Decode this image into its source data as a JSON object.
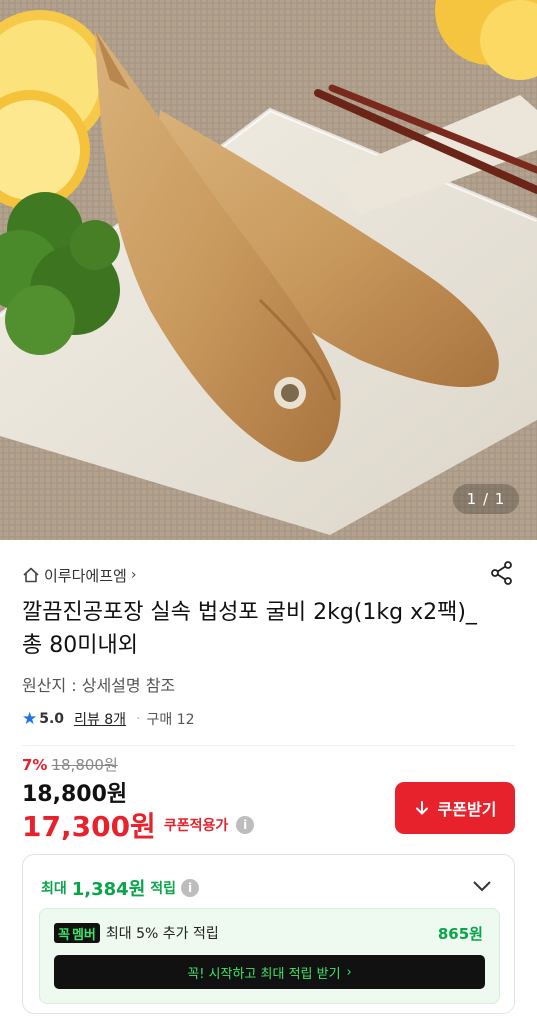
{
  "gallery": {
    "indicator": "1 / 1"
  },
  "store": {
    "name": "이루다에프엠"
  },
  "product": {
    "title": "깔끔진공포장 실속 법성포 굴비 2kg(1kg x2팩)_총 80미내외",
    "origin": "원산지 : 상세설명 참조"
  },
  "rating": {
    "score": "5.0",
    "reviews": "리뷰 8개",
    "purchases": "구매 12"
  },
  "price": {
    "discount_rate": "7%",
    "original": "18,800원",
    "sale": "18,800원",
    "coupon_price": "17,300원",
    "coupon_price_label": "쿠폰적용가"
  },
  "coupon_button": {
    "label": "쿠폰받기"
  },
  "reward": {
    "prefix": "최대",
    "amount": "1,384원",
    "suffix": "적립"
  },
  "membership": {
    "badge_part1": "꼭",
    "badge_part2": "멤버",
    "text": "최대 5% 추가 적립",
    "amount": "865원",
    "cta": "꼭! 시작하고 최대 적립 받기"
  },
  "colors": {
    "accent_red": "#e8222c",
    "accent_green": "#0aa44a",
    "star_blue": "#1e73e8"
  }
}
